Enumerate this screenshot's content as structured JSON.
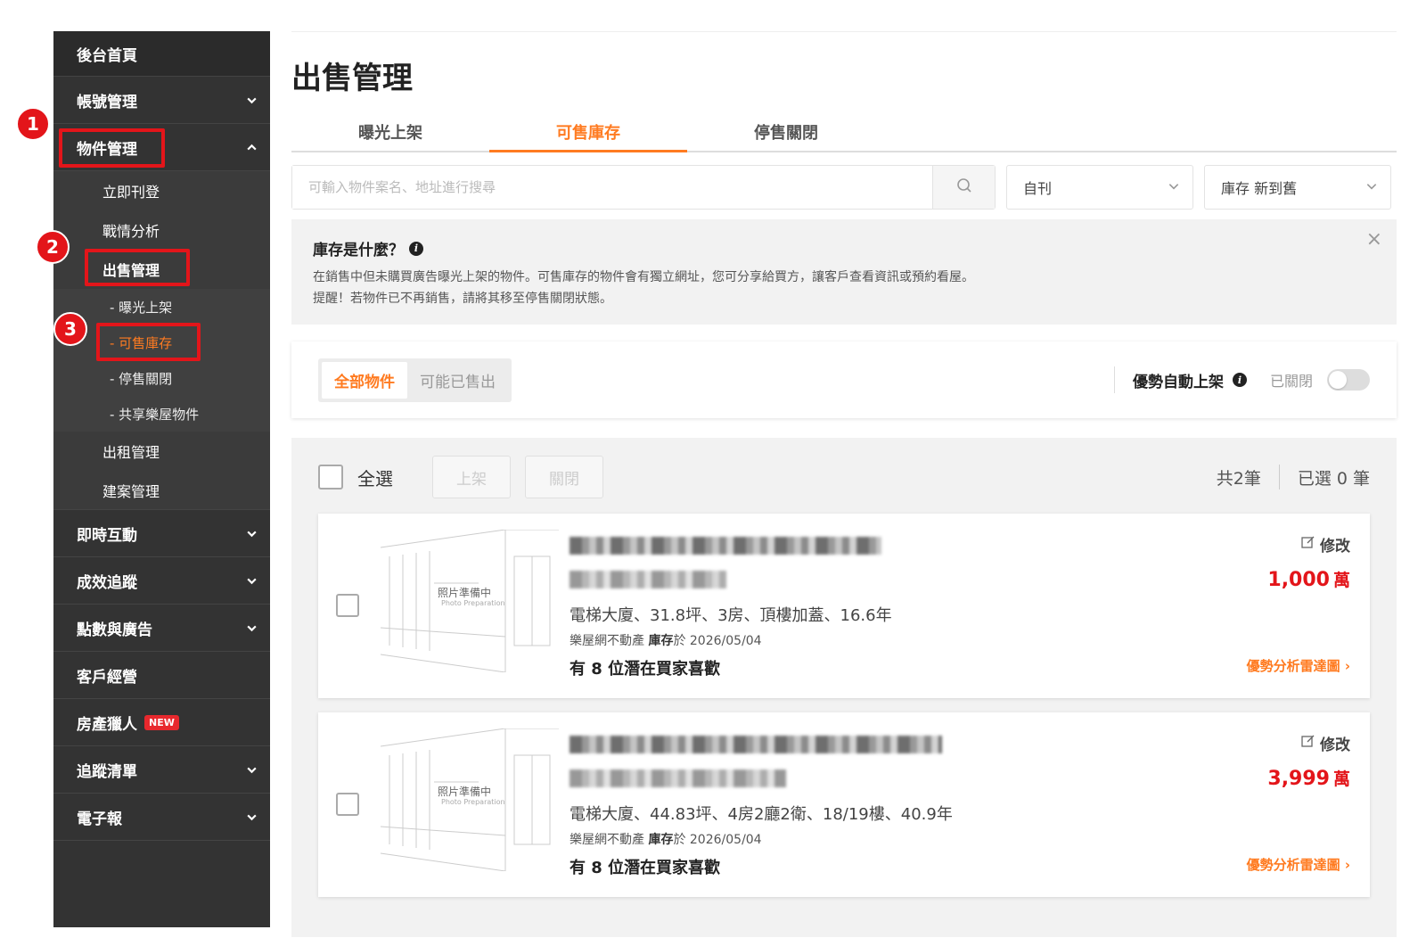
{
  "sidebar": {
    "home": "後台首頁",
    "account": "帳號管理",
    "property": "物件管理",
    "property_sub": {
      "post_now": "立即刊登",
      "analysis": "戰情分析",
      "sale_mgmt": "出售管理",
      "sale_sub": {
        "exposure": "- 曝光上架",
        "inventory": "- 可售庫存",
        "stopped": "- 停售關閉",
        "shared": "- 共享樂屋物件"
      },
      "rent_mgmt": "出租管理",
      "project_mgmt": "建案管理"
    },
    "interaction": "即時互動",
    "tracking": "成效追蹤",
    "points_ads": "點數與廣告",
    "customer": "客戶經營",
    "hunter": "房產獵人",
    "new_badge": "NEW",
    "watchlist": "追蹤清單",
    "newsletter": "電子報"
  },
  "annotations": {
    "step1": "1",
    "step2": "2",
    "step3": "3",
    "highlight_color": "#e3151a"
  },
  "main": {
    "title": "出售管理",
    "tabs": [
      "曝光上架",
      "可售庫存",
      "停售關閉"
    ],
    "search_placeholder": "可輸入物件案名、地址進行搜尋",
    "source_select": "自刊",
    "sort_select": "庫存 新到舊",
    "info": {
      "title": "庫存是什麼？",
      "line1": "在銷售中但未購買廣告曝光上架的物件。可售庫存的物件會有獨立網址，您可分享給買方，讓客戶查看資訊或預約看屋。",
      "line2": "提醒！若物件已不再銷售，請將其移至停售關閉狀態。"
    },
    "filter": {
      "all": "全部物件",
      "maybe_sold": "可能已售出",
      "auto_label": "優勢自動上架",
      "auto_status": "已關閉"
    },
    "toolbar": {
      "select_all": "全選",
      "publish": "上架",
      "close": "關閉",
      "total": "共2筆",
      "selected": "已選 0 筆"
    },
    "listings": [
      {
        "photo_text": "照片準備中",
        "photo_sub": "Photo Preparation",
        "spec": "電梯大廈、31.8坪、3房、頂樓加蓋、16.6年",
        "agency": "樂屋網不動產",
        "inventory_label": "庫存",
        "date": "於 2026/05/04",
        "fav": "有 8 位潛在買家喜歡",
        "edit": "修改",
        "price": "1,000",
        "unit": "萬",
        "radar": "優勢分析雷達圖 ›"
      },
      {
        "photo_text": "照片準備中",
        "photo_sub": "Photo Preparation",
        "spec": "電梯大廈、44.83坪、4房2廳2衛、18/19樓、40.9年",
        "agency": "樂屋網不動產",
        "inventory_label": "庫存",
        "date": "於 2026/05/04",
        "fav": "有 8 位潛在買家喜歡",
        "edit": "修改",
        "price": "3,999",
        "unit": "萬",
        "radar": "優勢分析雷達圖 ›"
      }
    ]
  },
  "colors": {
    "accent": "#ff7b21",
    "sidebar_bg": "#333333",
    "price": "#e3151a"
  }
}
